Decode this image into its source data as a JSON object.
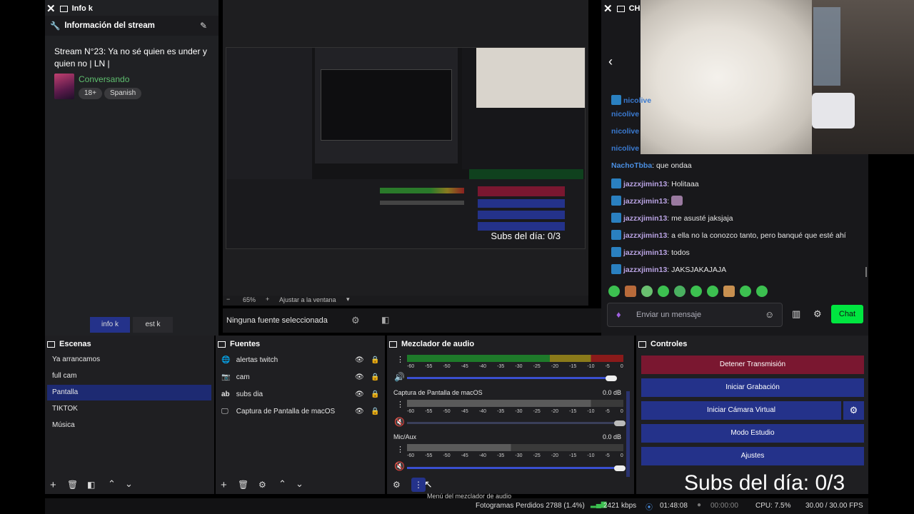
{
  "info_dock": {
    "window_title": "Info k",
    "header": "Información del stream",
    "stream_title": "Stream N°23: Ya no sé quien es under y quien no | LN |",
    "category": "Conversando",
    "tags": [
      "18+",
      "Spanish"
    ],
    "tabs": [
      "info k",
      "est k"
    ]
  },
  "preview": {
    "canvas_subs": "Subs del día: 0/3",
    "zoom": "65%",
    "fit_label": "Ajustar a la ventana",
    "no_source": "Ninguna fuente seleccionada"
  },
  "chat": {
    "window_title": "CHA",
    "messages": [
      {
        "user": "nicolive",
        "text": ""
      },
      {
        "user": "nicolive",
        "text": ""
      },
      {
        "user": "nicolive",
        "text": ""
      },
      {
        "user": "NachoTbba",
        "text": ": que ondaa"
      },
      {
        "user": "jazzxjimin13",
        "text": ": Holitaaa"
      },
      {
        "user": "jazzxjimin13",
        "text": ": "
      },
      {
        "user": "jazzxjimin13",
        "text": ": me asusté jaksjaja"
      },
      {
        "user": "jazzxjimin13",
        "text": ": a ella no la conozco tanto, pero banqué que esté ahí"
      },
      {
        "user": "jazzxjimin13",
        "text": ": todos"
      },
      {
        "user": "jazzxjimin13",
        "text": ": JAKSJAKAJAJA"
      }
    ],
    "input_placeholder": "Enviar un mensaje",
    "send_label": "Chat"
  },
  "scenes": {
    "title": "Escenas",
    "items": [
      "Ya arrancamos",
      "full cam",
      "Pantalla",
      "TIKTOK",
      "Música"
    ],
    "selected": "Pantalla"
  },
  "sources": {
    "title": "Fuentes",
    "items": [
      {
        "label": "alertas twitch",
        "icon": "browser-icon"
      },
      {
        "label": "cam",
        "icon": "camera-icon"
      },
      {
        "label": "subs dia",
        "icon": "text-icon"
      },
      {
        "label": "Captura de Pantalla de macOS",
        "icon": "monitor-icon"
      }
    ]
  },
  "mixer": {
    "title": "Mezclador de audio",
    "scale": [
      "-60",
      "-55",
      "-50",
      "-45",
      "-40",
      "-35",
      "-30",
      "-25",
      "-20",
      "-15",
      "-10",
      "-5",
      "0"
    ],
    "channels": [
      {
        "name": "",
        "db": "",
        "volume": 0.96
      },
      {
        "name": "Captura de Pantalla de macOS",
        "db": "0.0 dB",
        "volume": 1.0
      },
      {
        "name": "Mic/Aux",
        "db": "0.0 dB",
        "volume": 1.0
      }
    ],
    "menu_tooltip": "Menú del mezclador de audio"
  },
  "controls": {
    "title": "Controles",
    "buttons": [
      "Detener Transmisión",
      "Iniciar Grabación",
      "Iniciar Cámara Virtual",
      "Modo Estudio",
      "Ajustes"
    ]
  },
  "overlay_subs": "Subs del día: 0/3",
  "status": {
    "dropped": "Fotogramas Perdidos 2788 (1.4%)",
    "bitrate": "2421 kbps",
    "live_time": "01:48:08",
    "rec_time": "00:00:00",
    "cpu": "CPU: 7.5%",
    "fps": "30.00 / 30.00 FPS"
  },
  "colors": {
    "stop_button": "#7a1730",
    "control_button": "#24328a",
    "chat_accent": "#00e640",
    "selected_scene": "#1d2a72"
  }
}
